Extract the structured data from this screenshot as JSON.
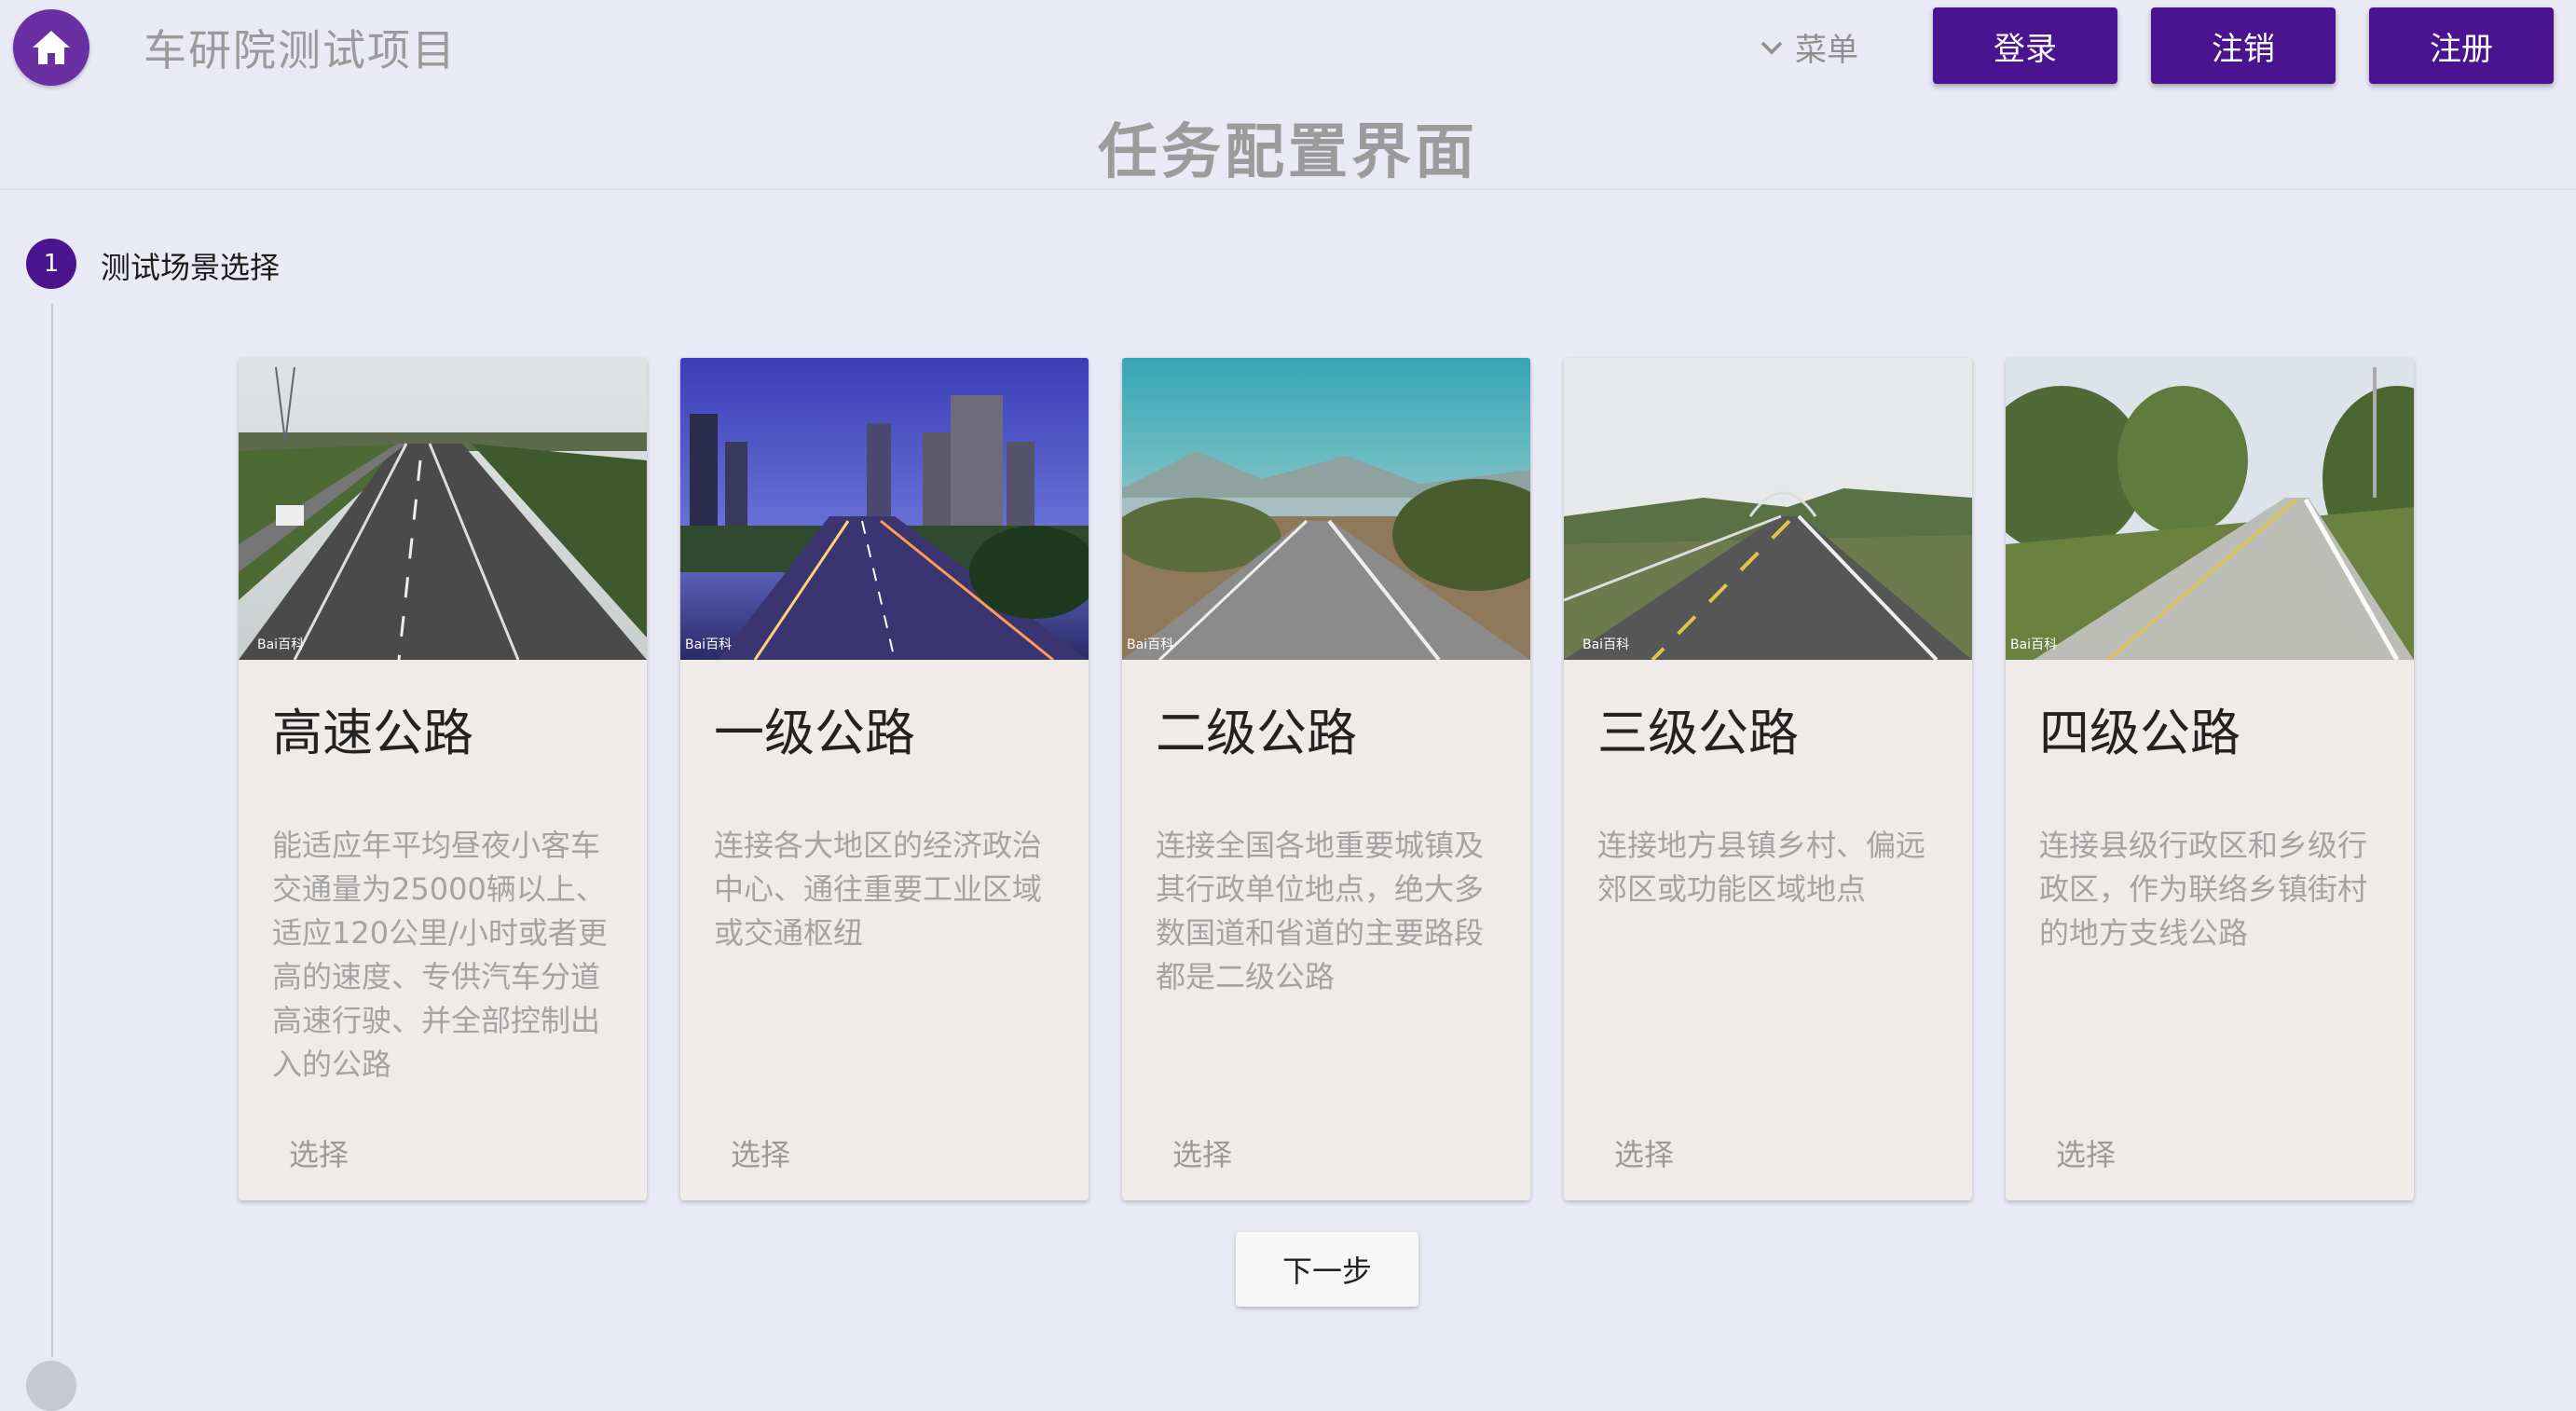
{
  "header": {
    "app_title": "车研院测试项目",
    "menu_label": "菜单",
    "buttons": {
      "login": "登录",
      "logout": "注销",
      "register": "注册"
    },
    "accent_color": "#4a1490"
  },
  "page": {
    "title": "任务配置界面"
  },
  "stepper": {
    "steps": [
      {
        "number": "1",
        "label": "测试场景选择"
      }
    ]
  },
  "cards": [
    {
      "title": "高速公路",
      "desc": "能适应年平均昼夜小客车交通量为25000辆以上、适应120公里/小时或者更高的速度、专供汽车分道高速行驶、并全部控制出入的公路",
      "action": "选择"
    },
    {
      "title": "一级公路",
      "desc": "连接各大地区的经济政治中心、通往重要工业区域或交通枢纽",
      "action": "选择"
    },
    {
      "title": "二级公路",
      "desc": "连接全国各地重要城镇及其行政单位地点，绝大多数国道和省道的主要路段都是二级公路",
      "action": "选择"
    },
    {
      "title": "三级公路",
      "desc": "连接地方县镇乡村、偏远郊区或功能区域地点",
      "action": "选择"
    },
    {
      "title": "四级公路",
      "desc": "连接县级行政区和乡级行政区，作为联络乡镇街村的地方支线公路",
      "action": "选择"
    }
  ],
  "next_button": "下一步"
}
